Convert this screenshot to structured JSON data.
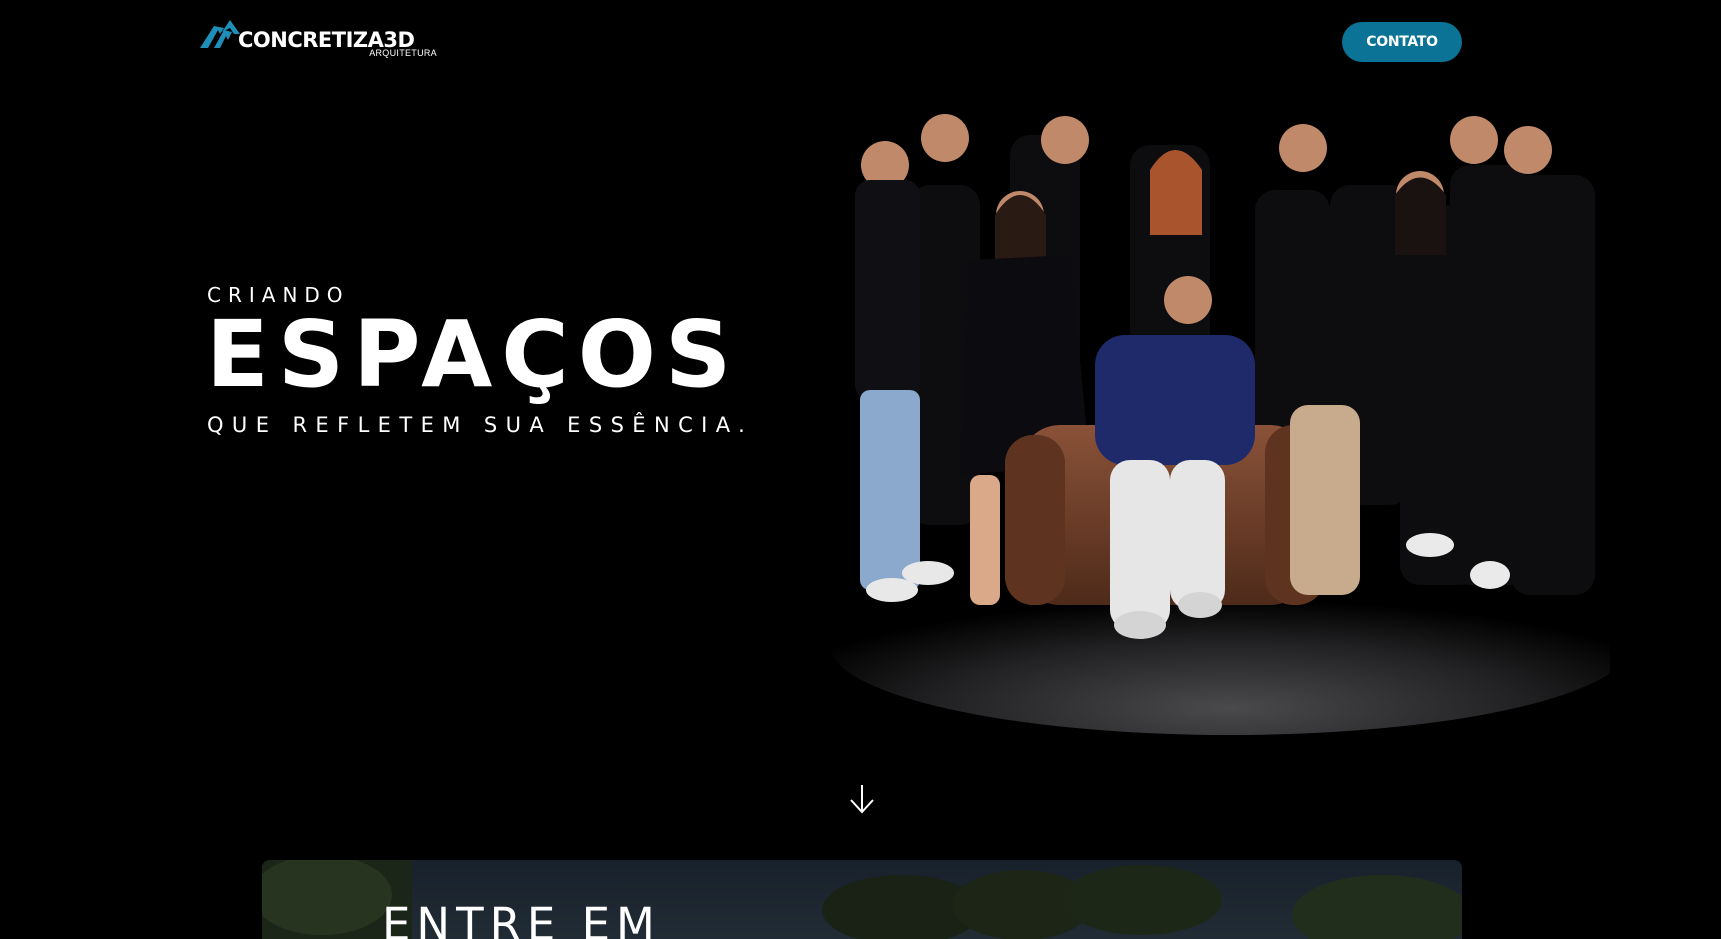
{
  "header": {
    "logo_name": "CONCRETIZA3D",
    "logo_tagline": "ARQUITETURA",
    "contact_label": "CONTATO"
  },
  "hero": {
    "kicker": "CRIANDO",
    "title": "ESPAÇOS",
    "subtitle": "QUE REFLETEM SUA ESSÊNCIA."
  },
  "scroll_icon": "arrow-down-icon",
  "card": {
    "title": "ENTRE EM"
  },
  "colors": {
    "brand": "#0a7396",
    "logo_accent": "#1e8fb8",
    "background": "#000000"
  }
}
